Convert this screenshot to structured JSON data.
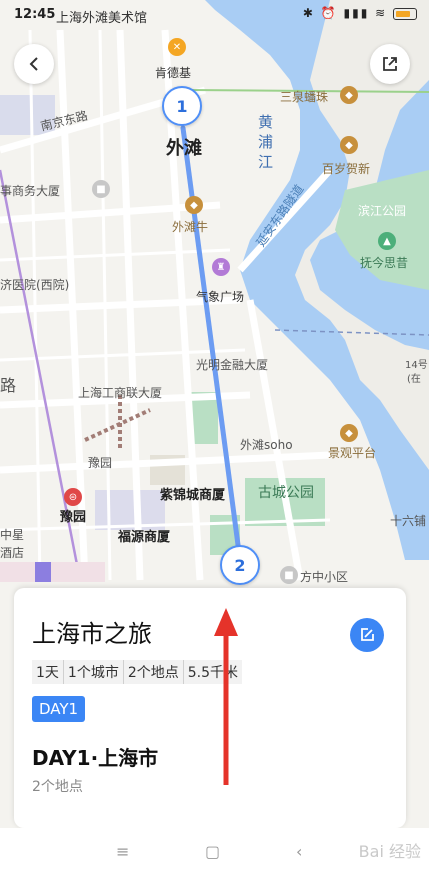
{
  "status_bar": {
    "time": "12:45",
    "current_place": "上海外滩美术馆",
    "icons": "✱ ⏰ ▮▮▮ ≋"
  },
  "map": {
    "labels": {
      "kfc": "肯德基",
      "sanquan": "三泉蟠珠",
      "nanjing_road": "南京东路",
      "huangpu_river": "黄浦江",
      "waitan": "外滩",
      "baisui": "百岁贺新",
      "binjiang_park": "滨江公园",
      "fujiang": "抚今思昔",
      "business_building": "事商务大厦",
      "waitan_niu": "外滩牛",
      "jiyi_hospital": "济医院(西院)",
      "qixiang": "气象广场",
      "yanan_road": "延安东路隧道",
      "guangming": "光明金融大厦",
      "gongshang": "上海工商联大厦",
      "waitan_soho": "外滩soho",
      "jingguan": "景观平台",
      "yuyuan_area": "豫园",
      "zijin": "紫锦城商厦",
      "gucheng_park": "古城公园",
      "yuyuan_station": "豫园",
      "fuyuan": "福源商厦",
      "fangzhong": "方中小区",
      "shiliupu": "十六铺",
      "lu": "路",
      "zhongxing": "中星",
      "jiudian": "酒店",
      "dist14": "14号",
      "zai": "(在"
    },
    "route": {
      "color": "#6c9cf2",
      "stops": [
        "1",
        "2"
      ]
    },
    "buttons": {
      "back": "back",
      "share": "share"
    }
  },
  "panel": {
    "title": "上海市之旅",
    "tags": [
      "1天",
      "1个城市",
      "2个地点",
      "5.5千米"
    ],
    "day_badge": "DAY1",
    "day_title": "DAY1·上海市",
    "day_subtitle": "2个地点"
  },
  "watermark": "Bai 经验",
  "colors": {
    "accent": "#3b86f5",
    "water": "#a9cdf4",
    "park": "#b9dfc4",
    "arrow": "#e5332a"
  }
}
